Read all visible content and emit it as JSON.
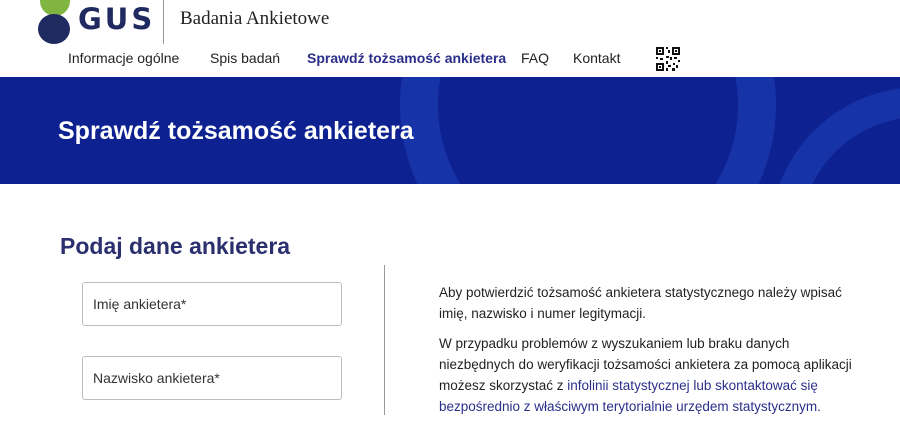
{
  "header": {
    "logo_text": "GUS",
    "site_title": "Badania Ankietowe",
    "colors": {
      "logo_green": "#80b541",
      "logo_navy": "#1f2a60"
    }
  },
  "nav": {
    "items": [
      {
        "label": "Informacje ogólne"
      },
      {
        "label": "Spis badań"
      },
      {
        "label": "Sprawdź tożsamość ankietera",
        "active": true
      },
      {
        "label": "FAQ"
      },
      {
        "label": "Kontakt"
      }
    ],
    "qr_icon": "qr-code-icon"
  },
  "banner": {
    "title": "Sprawdź tożsamość ankietera",
    "colors": {
      "background": "#0d2191",
      "ring": "#1733a8"
    }
  },
  "form": {
    "heading": "Podaj dane ankietera",
    "first_name_placeholder": "Imię ankietera*",
    "last_name_placeholder": "Nazwisko ankietera*"
  },
  "info": {
    "paragraph1": "Aby potwierdzić tożsamość ankietera statystycznego należy wpisać imię, nazwisko i numer legitymacji.",
    "paragraph2_prefix": "W przypadku problemów z wyszukaniem lub braku danych niezbędnych do weryfikacji tożsamości ankietera za pomocą aplikacji możesz skorzystać z ",
    "paragraph2_link": "infolinii statystycznej lub skontaktować się bezpośrednio z właściwym terytorialnie urzędem statystycznym."
  }
}
